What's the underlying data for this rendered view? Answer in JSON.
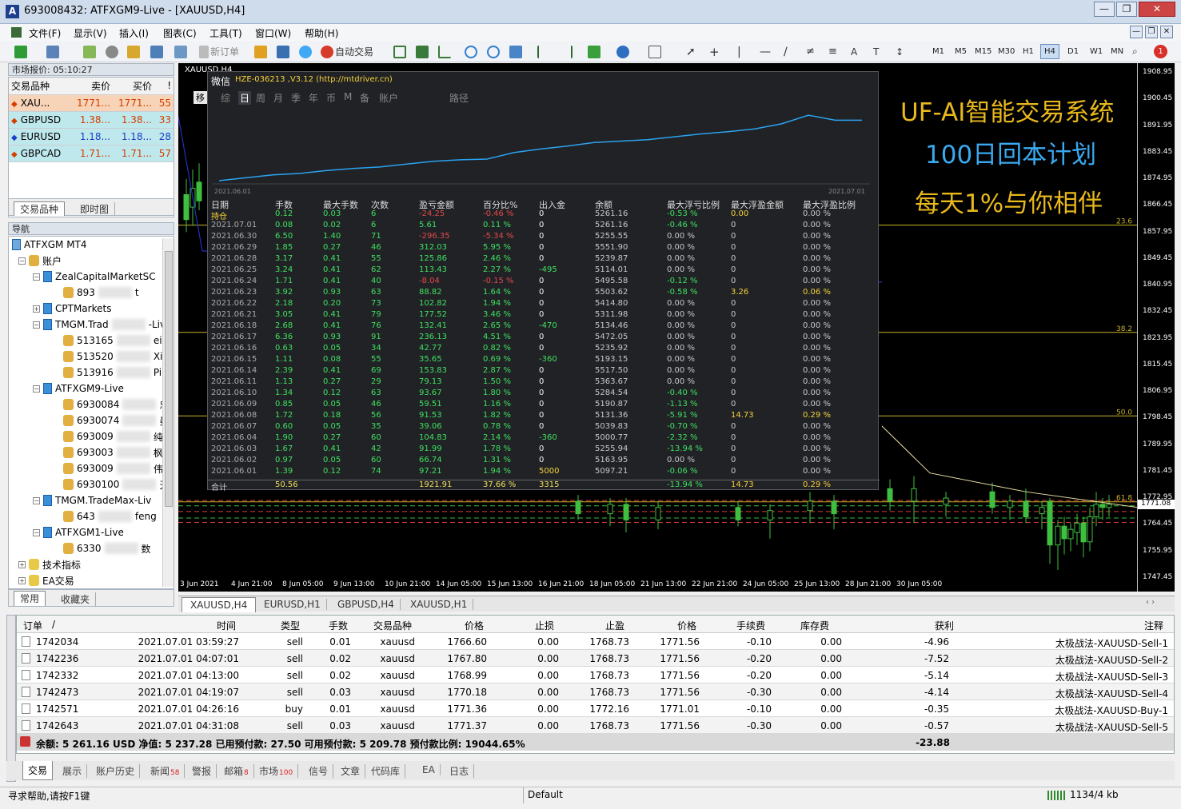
{
  "window": {
    "title": "693008432: ATFXGM9-Live - [XAUUSD,H4]",
    "app_icon_letter": "A",
    "controls": [
      "—",
      "❐",
      "✕"
    ],
    "doc_controls": [
      "—",
      "❐",
      "✕"
    ]
  },
  "menu": [
    "文件(F)",
    "显示(V)",
    "插入(I)",
    "图表(C)",
    "工具(T)",
    "窗口(W)",
    "帮助(H)"
  ],
  "toolbar": {
    "new_order": "新订单",
    "auto_trade": "自动交易",
    "timeframes": [
      "M1",
      "M5",
      "M15",
      "M30",
      "H1",
      "H4",
      "D1",
      "W1",
      "MN"
    ],
    "active_timeframe": "H4",
    "alert_count": "1"
  },
  "market_watch": {
    "title": "市场报价: 05:10:27",
    "headers": [
      "交易品种",
      "卖价",
      "买价",
      "!"
    ],
    "rows": [
      {
        "symbol": "XAU...",
        "bid": "1771...",
        "ask": "1771...",
        "spread": "55",
        "bg": "#f7d4b8",
        "color": "#d43d00"
      },
      {
        "symbol": "GBPUSD",
        "bid": "1.38...",
        "ask": "1.38...",
        "spread": "33",
        "bg": "#bfe8ec",
        "color": "#d43d00"
      },
      {
        "symbol": "EURUSD",
        "bid": "1.18...",
        "ask": "1.18...",
        "spread": "28",
        "bg": "#bfe8ec",
        "color": "#1a3fc7"
      },
      {
        "symbol": "GBPCAD",
        "bid": "1.71...",
        "ask": "1.71...",
        "spread": "57",
        "bg": "#bfe8ec",
        "color": "#d43d00"
      }
    ],
    "tabs": [
      "交易品种",
      "即时图"
    ]
  },
  "navigator": {
    "title": "导航",
    "root": "ATFXGM MT4",
    "accounts_label": "账户",
    "servers": [
      {
        "name": "ZealCapitalMarketSC",
        "accounts": [
          {
            "id": "893",
            "tail": "t"
          }
        ]
      },
      {
        "name": "CPTMarkets",
        "accounts": []
      },
      {
        "name": "TMGM.Trad",
        "suffix": "-Liv",
        "accounts": [
          {
            "id": "513165",
            "tail": "ei I"
          },
          {
            "id": "513520",
            "tail": "Xiar"
          },
          {
            "id": "513916",
            "tail": "Piu"
          }
        ]
      },
      {
        "name": "ATFXGM9-Live",
        "accounts": [
          {
            "id": "6930084",
            "tail": "忠"
          },
          {
            "id": "6930074",
            "tail": "曼"
          },
          {
            "id": "693009",
            "tail": "纯"
          },
          {
            "id": "693003",
            "tail": "枫"
          },
          {
            "id": "693009",
            "tail": "伟"
          },
          {
            "id": "6930100",
            "tail": "天"
          }
        ]
      },
      {
        "name": "TMGM.TradeMax-Liv",
        "accounts": [
          {
            "id": "643",
            "tail": "feng"
          }
        ]
      },
      {
        "name": "ATFXGM1-Live",
        "accounts": [
          {
            "id": "6330",
            "tail": "数"
          }
        ]
      }
    ],
    "extra": [
      "技术指标",
      "EA交易"
    ],
    "tabs": [
      "常用",
      "收藏夹"
    ]
  },
  "chart": {
    "symbol_label": "XAUUSD,H4",
    "price_labels": [
      "1908.95",
      "1900.45",
      "1891.95",
      "1883.45",
      "1874.95",
      "1866.45",
      "1857.95",
      "1849.45",
      "1840.95",
      "1832.45",
      "1823.95",
      "1815.45",
      "1806.95",
      "1798.45",
      "1789.95",
      "1781.45",
      "1772.95",
      "1764.45",
      "1755.95",
      "1747.45"
    ],
    "current_price": "1771.08",
    "time_labels": [
      "3 Jun 2021",
      "4 Jun 21:00",
      "8 Jun 05:00",
      "9 Jun 13:00",
      "10 Jun 21:00",
      "14 Jun 05:00",
      "15 Jun 13:00",
      "16 Jun 21:00",
      "18 Jun 05:00",
      "21 Jun 13:00",
      "22 Jun 21:00",
      "24 Jun 05:00",
      "25 Jun 13:00",
      "28 Jun 21:00",
      "30 Jun 05:00"
    ],
    "level_labels": [
      "23.6",
      "38.2",
      "50.0",
      "61.8"
    ],
    "promo": [
      "UF-AI智能交易系统",
      "100日回本计划",
      "每天1%与你相伴"
    ]
  },
  "overlay": {
    "app": "微信",
    "title": "HZE-036213 ,V3.12 (http://mtdriver.cn)",
    "side_btn": "移",
    "tabs": [
      "综",
      "日",
      "周",
      "月",
      "季",
      "年",
      "币",
      "M",
      "备",
      "账户",
      "路径"
    ],
    "active_tab": "日",
    "chart_start": "2021.06.01",
    "chart_end": "2021.07.01",
    "equity_points": [
      0.0,
      0.04,
      0.08,
      0.1,
      0.14,
      0.17,
      0.19,
      0.23,
      0.27,
      0.29,
      0.3,
      0.39,
      0.44,
      0.48,
      0.53,
      0.55,
      0.57,
      0.61,
      0.65,
      0.68,
      0.72,
      0.79,
      0.91,
      0.84,
      0.84
    ],
    "headers": [
      "日期",
      "手数",
      "最大手数",
      "次数",
      "盈亏金额",
      "百分比%",
      "出入金",
      "余额",
      "最大浮亏比例",
      "最大浮盈金额",
      "最大浮盈比例"
    ],
    "rows": [
      [
        "持仓",
        "0.12",
        "0.03",
        "6",
        "-24.25",
        "-0.46 %",
        "0",
        "5261.16",
        "-0.53 %",
        "0.00",
        "0.00 %"
      ],
      [
        "2021.07.01",
        "0.08",
        "0.02",
        "6",
        "5.61",
        "0.11 %",
        "0",
        "5261.16",
        "-0.46 %",
        "0",
        "0.00 %"
      ],
      [
        "2021.06.30",
        "6.50",
        "1.40",
        "71",
        "-296.35",
        "-5.34 %",
        "0",
        "5255.55",
        "0.00 %",
        "0",
        "0.00 %"
      ],
      [
        "2021.06.29",
        "1.85",
        "0.27",
        "46",
        "312.03",
        "5.95 %",
        "0",
        "5551.90",
        "0.00 %",
        "0",
        "0.00 %"
      ],
      [
        "2021.06.28",
        "3.17",
        "0.41",
        "55",
        "125.86",
        "2.46 %",
        "0",
        "5239.87",
        "0.00 %",
        "0",
        "0.00 %"
      ],
      [
        "2021.06.25",
        "3.24",
        "0.41",
        "62",
        "113.43",
        "2.27 %",
        "-495",
        "5114.01",
        "0.00 %",
        "0",
        "0.00 %"
      ],
      [
        "2021.06.24",
        "1.71",
        "0.41",
        "40",
        "-8.04",
        "-0.15 %",
        "0",
        "5495.58",
        "-0.12 %",
        "0",
        "0.00 %"
      ],
      [
        "2021.06.23",
        "3.92",
        "0.93",
        "63",
        "88.82",
        "1.64 %",
        "0",
        "5503.62",
        "-0.58 %",
        "3.26",
        "0.06 %"
      ],
      [
        "2021.06.22",
        "2.18",
        "0.20",
        "73",
        "102.82",
        "1.94 %",
        "0",
        "5414.80",
        "0.00 %",
        "0",
        "0.00 %"
      ],
      [
        "2021.06.21",
        "3.05",
        "0.41",
        "79",
        "177.52",
        "3.46 %",
        "0",
        "5311.98",
        "0.00 %",
        "0",
        "0.00 %"
      ],
      [
        "2021.06.18",
        "2.68",
        "0.41",
        "76",
        "132.41",
        "2.65 %",
        "-470",
        "5134.46",
        "0.00 %",
        "0",
        "0.00 %"
      ],
      [
        "2021.06.17",
        "6.36",
        "0.93",
        "91",
        "236.13",
        "4.51 %",
        "0",
        "5472.05",
        "0.00 %",
        "0",
        "0.00 %"
      ],
      [
        "2021.06.16",
        "0.63",
        "0.05",
        "34",
        "42.77",
        "0.82 %",
        "0",
        "5235.92",
        "0.00 %",
        "0",
        "0.00 %"
      ],
      [
        "2021.06.15",
        "1.11",
        "0.08",
        "55",
        "35.65",
        "0.69 %",
        "-360",
        "5193.15",
        "0.00 %",
        "0",
        "0.00 %"
      ],
      [
        "2021.06.14",
        "2.39",
        "0.41",
        "69",
        "153.83",
        "2.87 %",
        "0",
        "5517.50",
        "0.00 %",
        "0",
        "0.00 %"
      ],
      [
        "2021.06.11",
        "1.13",
        "0.27",
        "29",
        "79.13",
        "1.50 %",
        "0",
        "5363.67",
        "0.00 %",
        "0",
        "0.00 %"
      ],
      [
        "2021.06.10",
        "1.34",
        "0.12",
        "63",
        "93.67",
        "1.80 %",
        "0",
        "5284.54",
        "-0.40 %",
        "0",
        "0.00 %"
      ],
      [
        "2021.06.09",
        "0.85",
        "0.05",
        "46",
        "59.51",
        "1.16 %",
        "0",
        "5190.87",
        "-1.13 %",
        "0",
        "0.00 %"
      ],
      [
        "2021.06.08",
        "1.72",
        "0.18",
        "56",
        "91.53",
        "1.82 %",
        "0",
        "5131.36",
        "-5.91 %",
        "14.73",
        "0.29 %"
      ],
      [
        "2021.06.07",
        "0.60",
        "0.05",
        "35",
        "39.06",
        "0.78 %",
        "0",
        "5039.83",
        "-0.70 %",
        "0",
        "0.00 %"
      ],
      [
        "2021.06.04",
        "1.90",
        "0.27",
        "60",
        "104.83",
        "2.14 %",
        "-360",
        "5000.77",
        "-2.32 %",
        "0",
        "0.00 %"
      ],
      [
        "2021.06.03",
        "1.67",
        "0.41",
        "42",
        "91.99",
        "1.78 %",
        "0",
        "5255.94",
        "-13.94 %",
        "0",
        "0.00 %"
      ],
      [
        "2021.06.02",
        "0.97",
        "0.05",
        "60",
        "66.74",
        "1.31 %",
        "0",
        "5163.95",
        "0.00 %",
        "0",
        "0.00 %"
      ],
      [
        "2021.06.01",
        "1.39",
        "0.12",
        "74",
        "97.21",
        "1.94 %",
        "5000",
        "5097.21",
        "-0.06 %",
        "0",
        "0.00 %"
      ]
    ],
    "total": [
      "合计",
      "50.56",
      "",
      "",
      "1921.91",
      "37.66 %",
      "3315",
      "",
      "-13.94 %",
      "14.73",
      "0.29 %"
    ]
  },
  "chart_tabs": [
    "XAUUSD,H4",
    "EURUSD,H1",
    "GBPUSD,H4",
    "XAUUSD,H1"
  ],
  "terminal": {
    "headers": [
      "订单",
      "/",
      "时间",
      "类型",
      "手数",
      "交易品种",
      "价格",
      "止损",
      "止盈",
      "价格",
      "手续费",
      "库存费",
      "获利",
      "注释"
    ],
    "rows": [
      [
        "1742034",
        "2021.07.01 03:59:27",
        "sell",
        "0.01",
        "xauusd",
        "1766.60",
        "0.00",
        "1768.73",
        "1771.56",
        "-0.10",
        "0.00",
        "-4.96",
        "太极战法-XAUUSD-Sell-1"
      ],
      [
        "1742236",
        "2021.07.01 04:07:01",
        "sell",
        "0.02",
        "xauusd",
        "1767.80",
        "0.00",
        "1768.73",
        "1771.56",
        "-0.20",
        "0.00",
        "-7.52",
        "太极战法-XAUUSD-Sell-2"
      ],
      [
        "1742332",
        "2021.07.01 04:13:00",
        "sell",
        "0.02",
        "xauusd",
        "1768.99",
        "0.00",
        "1768.73",
        "1771.56",
        "-0.20",
        "0.00",
        "-5.14",
        "太极战法-XAUUSD-Sell-3"
      ],
      [
        "1742473",
        "2021.07.01 04:19:07",
        "sell",
        "0.03",
        "xauusd",
        "1770.18",
        "0.00",
        "1768.73",
        "1771.56",
        "-0.30",
        "0.00",
        "-4.14",
        "太极战法-XAUUSD-Sell-4"
      ],
      [
        "1742571",
        "2021.07.01 04:26:16",
        "buy",
        "0.01",
        "xauusd",
        "1771.36",
        "0.00",
        "1772.16",
        "1771.01",
        "-0.10",
        "0.00",
        "-0.35",
        "太极战法-XAUUSD-Buy-1"
      ],
      [
        "1742643",
        "2021.07.01 04:31:08",
        "sell",
        "0.03",
        "xauusd",
        "1771.37",
        "0.00",
        "1768.73",
        "1771.56",
        "-0.30",
        "0.00",
        "-0.57",
        "太极战法-XAUUSD-Sell-5"
      ]
    ],
    "summary": "余额: 5 261.16 USD  净值: 5 237.28  已用预付款: 27.50  可用预付款: 5 209.78  预付款比例: 19044.65%",
    "summary_profit": "-23.88",
    "tabs": [
      {
        "label": "交易",
        "badge": ""
      },
      {
        "label": "展示",
        "badge": ""
      },
      {
        "label": "账户历史",
        "badge": ""
      },
      {
        "label": "新闻",
        "badge": "58"
      },
      {
        "label": "警报",
        "badge": ""
      },
      {
        "label": "邮箱",
        "badge": "8"
      },
      {
        "label": "市场",
        "badge": "100"
      },
      {
        "label": "信号",
        "badge": ""
      },
      {
        "label": "文章",
        "badge": ""
      },
      {
        "label": "代码库",
        "badge": ""
      },
      {
        "label": "EA",
        "badge": ""
      },
      {
        "label": "日志",
        "badge": ""
      }
    ],
    "side_label": "终端"
  },
  "status": {
    "help": "寻求帮助,请按F1键",
    "profile": "Default",
    "traffic": "1134/4 kb"
  }
}
